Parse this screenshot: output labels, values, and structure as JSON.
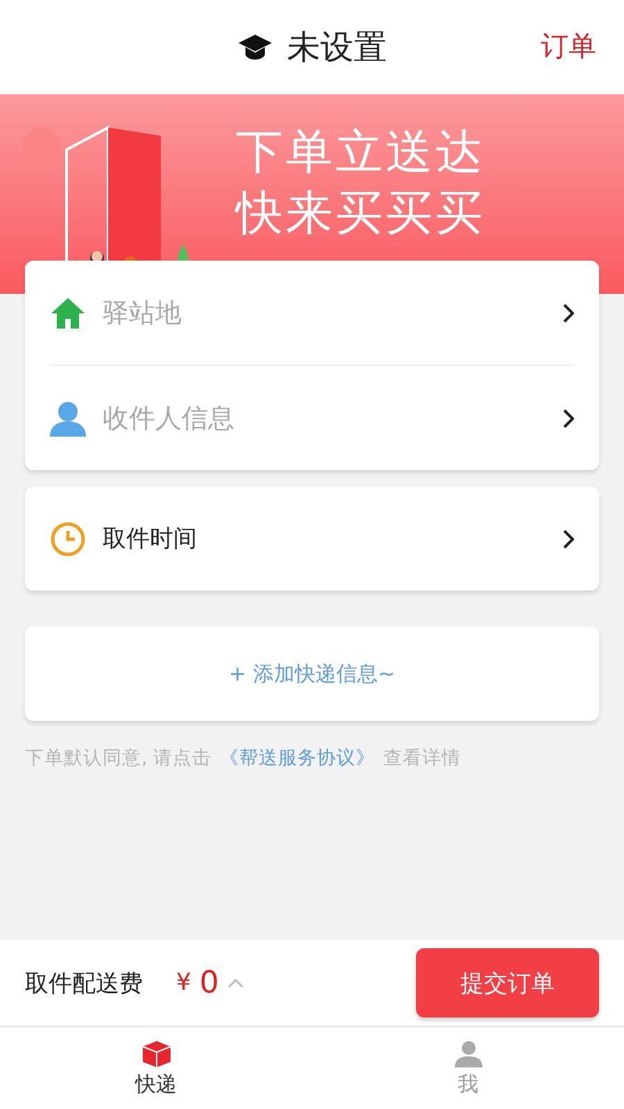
{
  "header": {
    "title": "未设置",
    "action": "订单"
  },
  "banner": {
    "lines": [
      "下单立送达",
      "快来买买买"
    ]
  },
  "address_card": {
    "items": [
      {
        "kind": "station",
        "placeholder": "驿站地"
      },
      {
        "kind": "recipient",
        "placeholder": "收件人信息"
      }
    ]
  },
  "time_card": {
    "label": "取件时间"
  },
  "add_button": "+ 添加快递信息~",
  "agreement": {
    "before": "下单默认同意, 请点击",
    "link": "《帮送服务协议》",
    "after": "查看详情"
  },
  "footer": {
    "fee_label": "取件配送费",
    "currency": "¥",
    "amount": "0",
    "submit": "提交订单"
  },
  "tabs": [
    {
      "kind": "express",
      "label": "快递",
      "selected": true
    },
    {
      "kind": "me",
      "label": "我",
      "selected": false
    }
  ]
}
